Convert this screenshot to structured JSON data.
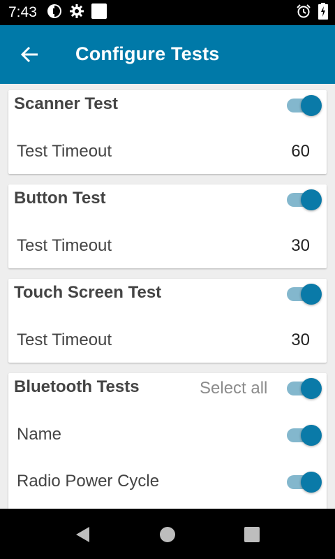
{
  "status_bar": {
    "time": "7:43"
  },
  "app_bar": {
    "title": "Configure Tests"
  },
  "cards": {
    "scanner": {
      "title": "Scanner Test",
      "enabled": true,
      "timeout_label": "Test Timeout",
      "timeout_value": "60"
    },
    "button": {
      "title": "Button Test",
      "enabled": true,
      "timeout_label": "Test Timeout",
      "timeout_value": "30"
    },
    "touch": {
      "title": "Touch Screen Test",
      "enabled": true,
      "timeout_label": "Test Timeout",
      "timeout_value": "30"
    },
    "bluetooth": {
      "title": "Bluetooth Tests",
      "select_all_label": "Select all",
      "select_all_enabled": true,
      "items": [
        {
          "label": "Name",
          "enabled": true
        },
        {
          "label": "Radio Power Cycle",
          "enabled": true
        }
      ]
    }
  },
  "colors": {
    "app_bar": "#0079a8",
    "toggle_thumb": "#0a7aa8",
    "toggle_track": "#83b7cd",
    "background": "#eeeeee"
  },
  "icons": {
    "status_left": [
      "data-saver-icon",
      "settings-gear-icon",
      "blank-square-icon"
    ],
    "status_right": [
      "alarm-icon",
      "battery-charging-icon"
    ],
    "nav": [
      "nav-back-icon",
      "nav-home-icon",
      "nav-recents-icon"
    ]
  }
}
